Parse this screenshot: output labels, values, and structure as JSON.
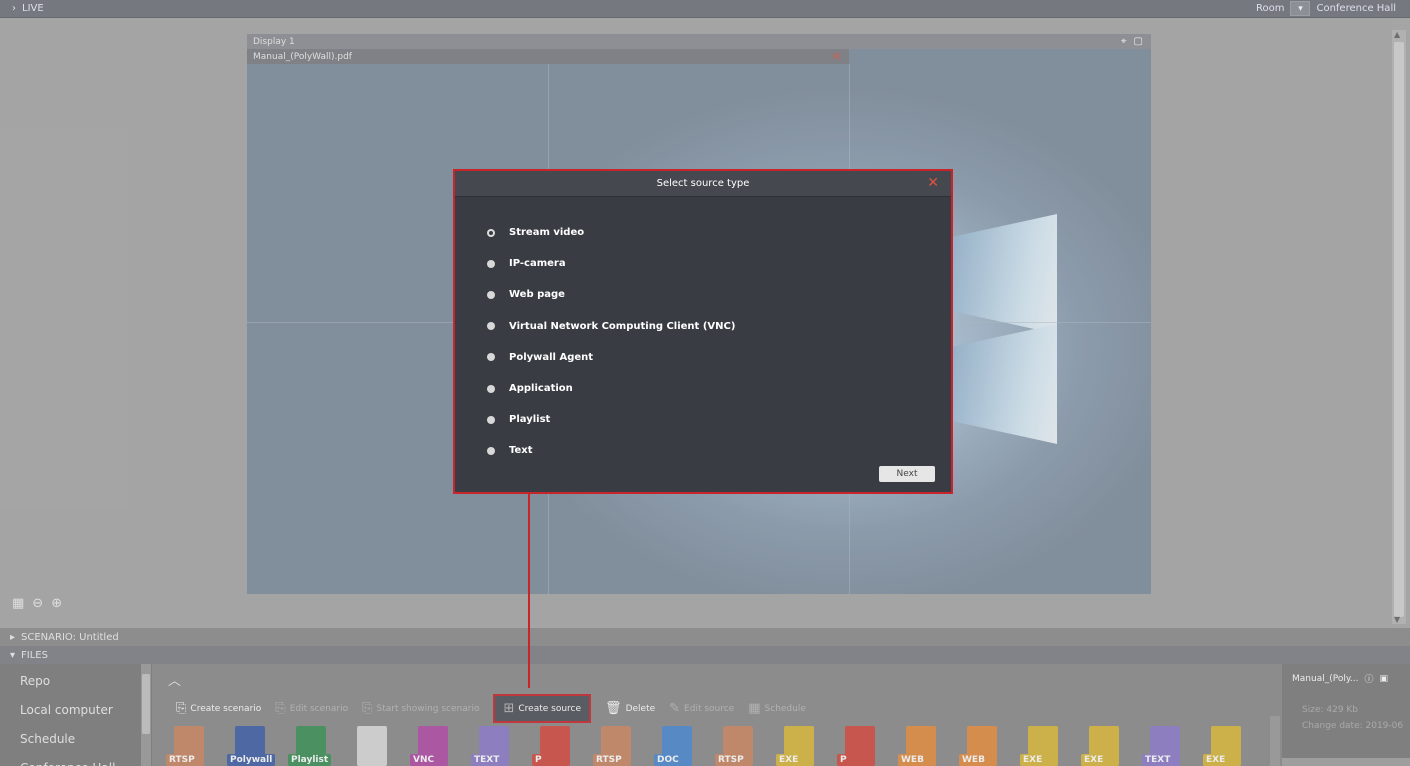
{
  "topbar": {
    "live_label": "LIVE",
    "room_label": "Room",
    "room_value": "Conference Hall"
  },
  "display": {
    "title": "Display 1",
    "file_name": "Manual_(PolyWall).pdf"
  },
  "modal": {
    "title": "Select source type",
    "options": [
      {
        "label": "Stream video",
        "selected": true
      },
      {
        "label": "IP-camera",
        "selected": false
      },
      {
        "label": "Web page",
        "selected": false
      },
      {
        "label": "Virtual Network Computing Client (VNC)",
        "selected": false
      },
      {
        "label": "Polywall Agent",
        "selected": false
      },
      {
        "label": "Application",
        "selected": false
      },
      {
        "label": "Playlist",
        "selected": false
      },
      {
        "label": "Text",
        "selected": false
      }
    ],
    "next_label": "Next"
  },
  "scenario": {
    "label": "SCENARIO: Untitled"
  },
  "files": {
    "label": "FILES"
  },
  "leftnav": {
    "items": [
      "Repo",
      "Local computer",
      "Schedule",
      "Conference Hall"
    ]
  },
  "toolbar": {
    "create_scenario": "Create scenario",
    "edit_scenario": "Edit scenario",
    "start_showing_scenario": "Start showing scenario",
    "create_source": "Create source",
    "delete": "Delete",
    "edit_source": "Edit source",
    "schedule": "Schedule"
  },
  "thumbs": [
    {
      "label": "RTSP",
      "color": "#c98562"
    },
    {
      "label": "Polywall",
      "color": "#3d5fa6"
    },
    {
      "label": "Playlist",
      "color": "#3a8f56"
    },
    {
      "label": "",
      "color": "#d8d8d8"
    },
    {
      "label": "VNC",
      "color": "#b04aa5"
    },
    {
      "label": "TEXT",
      "color": "#8a79c9"
    },
    {
      "label": "P",
      "color": "#d24a3f"
    },
    {
      "label": "RTSP",
      "color": "#c98562"
    },
    {
      "label": "DOC",
      "color": "#4a88d0"
    },
    {
      "label": "RTSP",
      "color": "#c98562"
    },
    {
      "label": "EXE",
      "color": "#d8b83a"
    },
    {
      "label": "P",
      "color": "#d24a3f"
    },
    {
      "label": "WEB",
      "color": "#e38b3f"
    },
    {
      "label": "WEB",
      "color": "#e38b3f"
    },
    {
      "label": "EXE",
      "color": "#d8b83a"
    },
    {
      "label": "EXE",
      "color": "#d8b83a"
    },
    {
      "label": "TEXT",
      "color": "#8a79c9"
    },
    {
      "label": "EXE",
      "color": "#d8b83a"
    }
  ],
  "rightpanel": {
    "name": "Manual_(Poly...",
    "size": "Size: 429 Kb",
    "change_date": "Change date: 2019-06"
  },
  "colors": {
    "accent_red": "#c8242a",
    "modal_bg": "#3a3c44"
  }
}
